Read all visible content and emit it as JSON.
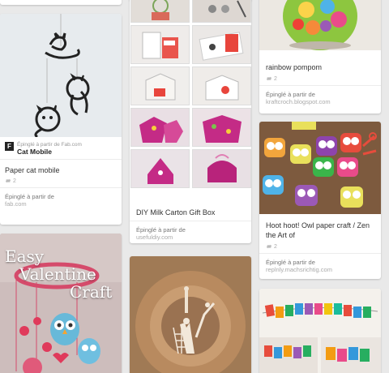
{
  "pins": {
    "cat_mobile": {
      "attribution_prefix": "Épinglé à partir de",
      "attribution_source": "Fab.com",
      "board": "Cat Mobile",
      "description": "Paper cat mobile",
      "repins": "2",
      "via_label": "Épinglé à partir de",
      "via_source": "fab.com"
    },
    "milk_carton": {
      "description": "DIY Milk Carton Gift Box",
      "via_label": "Épinglé à partir de",
      "via_source": "usefuldiy.com"
    },
    "pompom": {
      "description": "rainbow pompom",
      "repins": "2",
      "via_label": "Épinglé à partir de",
      "via_source": "kraftcroch.blogspot.com"
    },
    "owls": {
      "description": "Hoot hoot! Owl paper craft / Zen the Art of",
      "repins": "2",
      "via_label": "Épinglé à partir de",
      "via_source": "replnly.machsrichtig.com"
    },
    "valentine": {
      "line1": "Easy",
      "line2": "Valentine",
      "line3": "Craft"
    }
  },
  "colors": {
    "background": "#e9e9e9",
    "card": "#ffffff"
  },
  "icons": {
    "repin": "repin-icon",
    "logo": "fab-logo-icon"
  }
}
